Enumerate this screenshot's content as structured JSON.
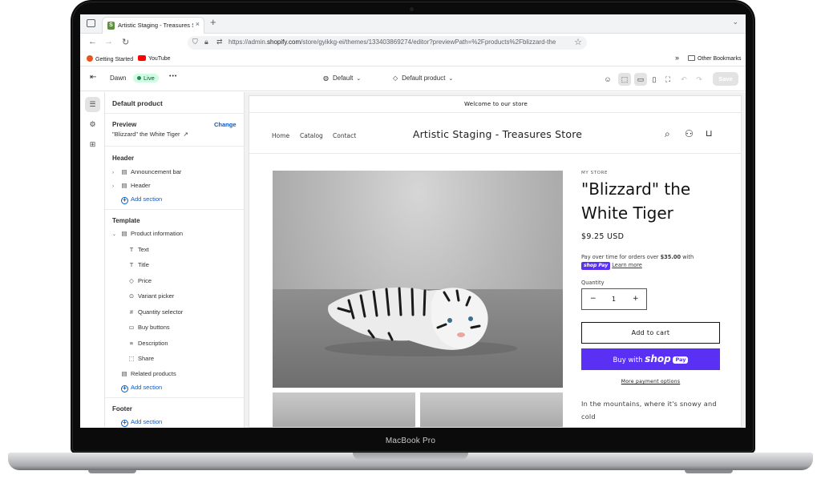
{
  "device": {
    "label": "MacBook Pro"
  },
  "browser": {
    "tab": {
      "title": "Artistic Staging - Treasures Sto",
      "close": "×"
    },
    "new_tab": "+",
    "tab_menu": "⌄",
    "nav": {
      "back": "←",
      "forward": "→",
      "reload": "↻"
    },
    "url": {
      "prefix": "https://admin.",
      "domain": "shopify.com",
      "rest": "/store/gyikkg-ei/themes/133403869274/editor?previewPath=%2Fproducts%2Fblizzard-the"
    },
    "bookmarks": [
      {
        "label": "Getting Started",
        "color": "#e8541e"
      },
      {
        "label": "YouTube",
        "color": "#ff0000"
      }
    ],
    "other_bookmarks": "Other Bookmarks"
  },
  "editor": {
    "theme_name": "Dawn",
    "status": "Live",
    "more": "•••",
    "theme_select": "Default",
    "template_select": "Default product",
    "save": "Save"
  },
  "panel": {
    "title": "Default product",
    "preview_label": "Preview",
    "change": "Change",
    "preview_item": "\"Blizzard\" the White Tiger",
    "header_group": "Header",
    "header_items": [
      "Announcement bar",
      "Header"
    ],
    "add_section": "Add section",
    "template_group": "Template",
    "product_information": "Product information",
    "blocks": [
      "Text",
      "Title",
      "Price",
      "Variant picker",
      "Quantity selector",
      "Buy buttons",
      "Description",
      "Share"
    ],
    "related_products": "Related products",
    "footer_group": "Footer"
  },
  "store": {
    "announcement": "Welcome to our store",
    "nav": [
      "Home",
      "Catalog",
      "Contact"
    ],
    "name": "Artistic Staging - Treasures Store",
    "vendor": "MY STORE",
    "product_title": "\"Blizzard\" the White Tiger",
    "price": "$9.25 USD",
    "installments_prefix": "Pay over time for orders over ",
    "installments_amount": "$35.00",
    "installments_suffix": " with",
    "shop_pay": "shop Pay",
    "learn_more": "Learn more",
    "quantity_label": "Quantity",
    "quantity_value": "1",
    "add_to_cart": "Add to cart",
    "buy_with": "Buy with",
    "buy_shop": "shop",
    "buy_pay": "Pay",
    "more_payment": "More payment options",
    "description": "In the mountains, where it's snowy and cold"
  },
  "colors": {
    "shop_pay_purple": "#5a31f4",
    "live_green": "#cdfee1",
    "link_blue": "#005bd3"
  }
}
